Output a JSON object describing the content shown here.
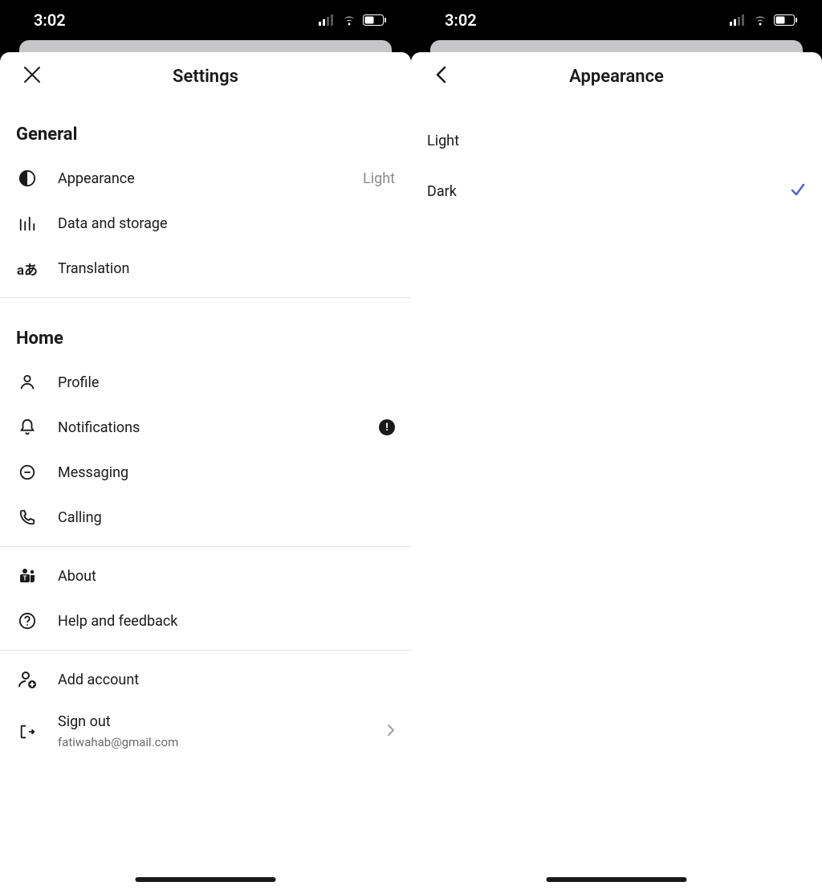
{
  "status": {
    "time": "3:02"
  },
  "left": {
    "title": "Settings",
    "sections": {
      "general": {
        "header": "General",
        "appearance": {
          "label": "Appearance",
          "value": "Light"
        },
        "data_storage": {
          "label": "Data and storage"
        },
        "translation": {
          "label": "Translation"
        }
      },
      "home": {
        "header": "Home",
        "profile": {
          "label": "Profile"
        },
        "notifications": {
          "label": "Notifications",
          "badge": "!"
        },
        "messaging": {
          "label": "Messaging"
        },
        "calling": {
          "label": "Calling"
        }
      },
      "info": {
        "about": {
          "label": "About"
        },
        "help": {
          "label": "Help and feedback"
        }
      },
      "account": {
        "add": {
          "label": "Add account"
        },
        "signout": {
          "label": "Sign out",
          "email": "fatiwahab@gmail.com"
        }
      }
    }
  },
  "right": {
    "title": "Appearance",
    "options": {
      "light": {
        "label": "Light",
        "selected": false
      },
      "dark": {
        "label": "Dark",
        "selected": true
      }
    }
  }
}
